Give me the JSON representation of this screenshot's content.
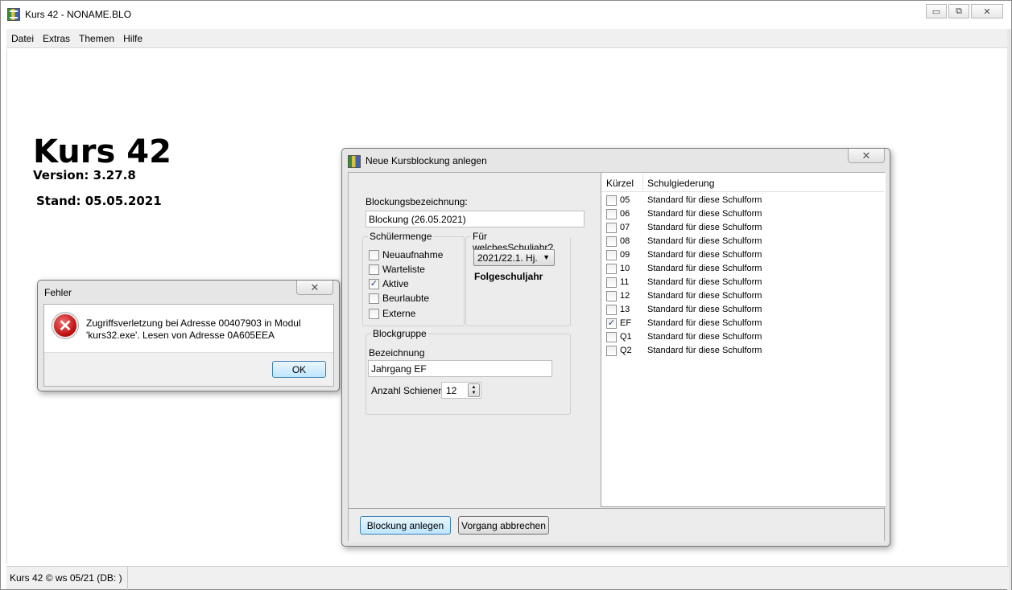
{
  "window": {
    "title": "Kurs 42 - NONAME.BLO",
    "minimize_glyph": "▭",
    "maximize_glyph": "⧉",
    "close_glyph": "✕"
  },
  "menu": {
    "items": [
      {
        "label": "Datei"
      },
      {
        "label": "Extras"
      },
      {
        "label": "Themen"
      },
      {
        "label": "Hilfe"
      }
    ]
  },
  "splash": {
    "title": "Kurs 42",
    "version": "Version: 3.27.8",
    "stand": "Stand: 05.05.2021"
  },
  "statusbar": {
    "text": "Kurs 42 © ws 05/21 (DB: )"
  },
  "error_dialog": {
    "title": "Fehler",
    "icon": "error-icon",
    "icon_glyph": "✕",
    "message": "Zugriffsverletzung bei Adresse 00407903 in Modul 'kurs32.exe'. Lesen von Adresse 0A605EEA",
    "ok_label": "OK",
    "close_glyph": "✕"
  },
  "kursblockung_dialog": {
    "title": "Neue Kursblockung anlegen",
    "close_glyph": "✕",
    "blockungsbezeichnung_label": "Blockungsbezeichnung:",
    "blockungsbezeichnung_value": "Blockung (26.05.2021)",
    "schuelermenge": {
      "label": "Schülermenge",
      "options": [
        {
          "label": "Neuaufnahme",
          "checked": false
        },
        {
          "label": "Warteliste",
          "checked": false
        },
        {
          "label": "Aktive",
          "checked": true
        },
        {
          "label": "Beurlaubte",
          "checked": false
        },
        {
          "label": "Externe",
          "checked": false
        }
      ]
    },
    "schuljahr": {
      "label": "Für welchesSchuljahr?",
      "selected": "2021/22.1. Hj.",
      "note": "Folgeschuljahr"
    },
    "blockgruppe": {
      "label": "Blockgruppe",
      "bezeichnung_label": "Bezeichnung",
      "bezeichnung_value": "Jahrgang EF",
      "schienen_label": "Anzahl Schienen",
      "schienen_value": "12"
    },
    "list": {
      "col_kuerzel": "Kürzel",
      "col_schulgliederung": "Schulgiederung",
      "rows": [
        {
          "kuerzel": "05",
          "gliederung": "Standard für diese Schulform",
          "checked": false
        },
        {
          "kuerzel": "06",
          "gliederung": "Standard für diese Schulform",
          "checked": false
        },
        {
          "kuerzel": "07",
          "gliederung": "Standard für diese Schulform",
          "checked": false
        },
        {
          "kuerzel": "08",
          "gliederung": "Standard für diese Schulform",
          "checked": false
        },
        {
          "kuerzel": "09",
          "gliederung": "Standard für diese Schulform",
          "checked": false
        },
        {
          "kuerzel": "10",
          "gliederung": "Standard für diese Schulform",
          "checked": false
        },
        {
          "kuerzel": "11",
          "gliederung": "Standard für diese Schulform",
          "checked": false
        },
        {
          "kuerzel": "12",
          "gliederung": "Standard für diese Schulform",
          "checked": false
        },
        {
          "kuerzel": "13",
          "gliederung": "Standard für diese Schulform",
          "checked": false
        },
        {
          "kuerzel": "EF",
          "gliederung": "Standard für diese Schulform",
          "checked": true
        },
        {
          "kuerzel": "Q1",
          "gliederung": "Standard für diese Schulform",
          "checked": false
        },
        {
          "kuerzel": "Q2",
          "gliederung": "Standard für diese Schulform",
          "checked": false
        }
      ]
    },
    "buttons": {
      "create": "Blockung anlegen",
      "cancel": "Vorgang abbrechen"
    }
  }
}
